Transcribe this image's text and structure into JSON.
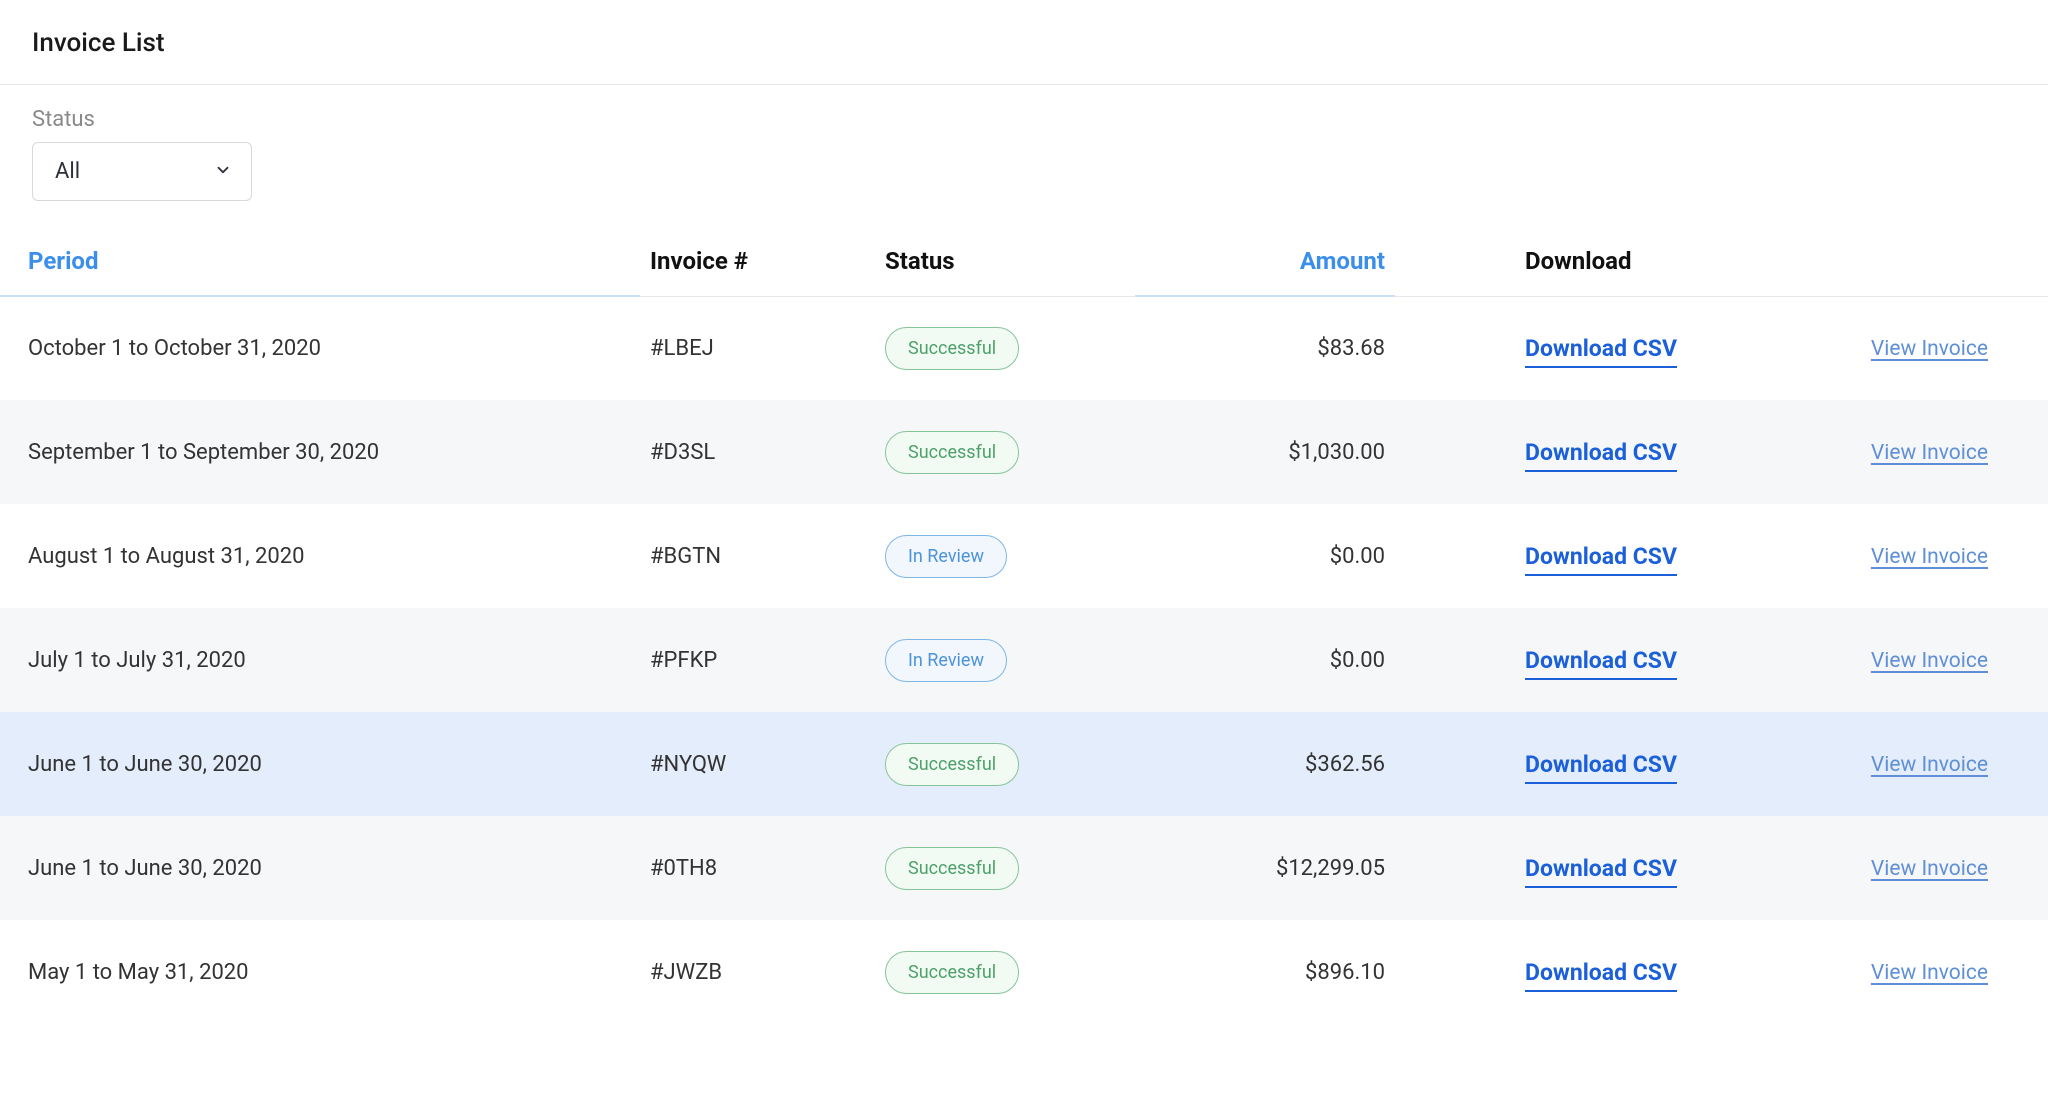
{
  "page": {
    "title": "Invoice List"
  },
  "filters": {
    "status_label": "Status",
    "status_value": "All"
  },
  "table": {
    "headers": {
      "period": "Period",
      "invoice": "Invoice #",
      "status": "Status",
      "amount": "Amount",
      "download": "Download"
    },
    "download_label": "Download CSV",
    "view_label": "View Invoice",
    "rows": [
      {
        "period": "October 1 to October 31, 2020",
        "invoice": "#LBEJ",
        "status": "Successful",
        "status_kind": "success",
        "amount": "$83.68",
        "hovered": false
      },
      {
        "period": "September 1 to September 30, 2020",
        "invoice": "#D3SL",
        "status": "Successful",
        "status_kind": "success",
        "amount": "$1,030.00",
        "hovered": false
      },
      {
        "period": "August 1 to August 31, 2020",
        "invoice": "#BGTN",
        "status": "In Review",
        "status_kind": "review",
        "amount": "$0.00",
        "hovered": false
      },
      {
        "period": "July 1 to July 31, 2020",
        "invoice": "#PFKP",
        "status": "In Review",
        "status_kind": "review",
        "amount": "$0.00",
        "hovered": false
      },
      {
        "period": "June 1 to June 30, 2020",
        "invoice": "#NYQW",
        "status": "Successful",
        "status_kind": "success",
        "amount": "$362.56",
        "hovered": true
      },
      {
        "period": "June 1 to June 30, 2020",
        "invoice": "#0TH8",
        "status": "Successful",
        "status_kind": "success",
        "amount": "$12,299.05",
        "hovered": false
      },
      {
        "period": "May 1 to May 31, 2020",
        "invoice": "#JWZB",
        "status": "Successful",
        "status_kind": "success",
        "amount": "$896.10",
        "hovered": false
      }
    ]
  }
}
